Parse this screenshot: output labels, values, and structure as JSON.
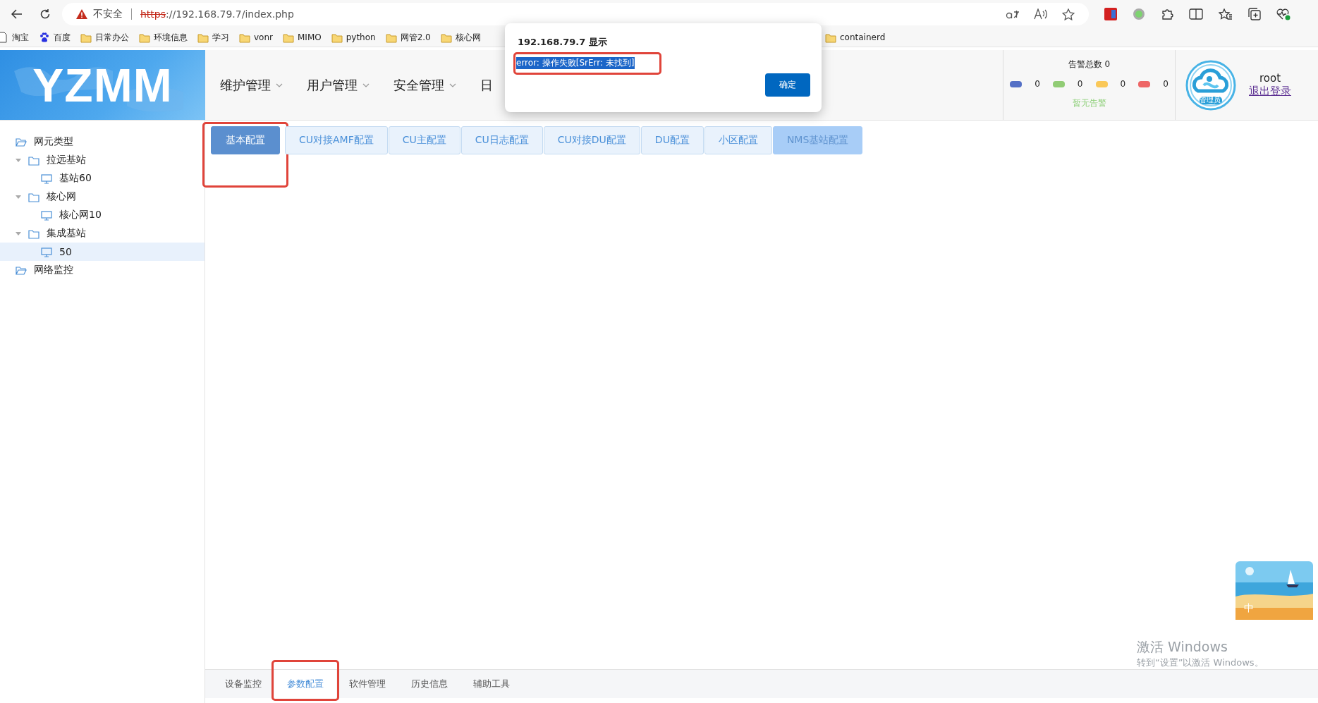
{
  "browser": {
    "security_label": "不安全",
    "url_scheme": "https",
    "url_rest": "://192.168.79.7/index.php",
    "bookmarks_left": [
      {
        "kind": "page",
        "label": "淘宝"
      },
      {
        "kind": "paw",
        "label": "百度"
      },
      {
        "kind": "folder",
        "label": "日常办公"
      },
      {
        "kind": "folder",
        "label": "环境信息"
      },
      {
        "kind": "folder",
        "label": "学习"
      },
      {
        "kind": "folder",
        "label": "vonr"
      },
      {
        "kind": "folder",
        "label": "MIMO"
      },
      {
        "kind": "folder",
        "label": "python"
      },
      {
        "kind": "folder",
        "label": "网管2.0"
      },
      {
        "kind": "folder",
        "label": "核心网"
      }
    ],
    "bookmarks_right": [
      {
        "kind": "folder",
        "label": "containerd"
      }
    ]
  },
  "header": {
    "logo": "YZMM",
    "nav": [
      {
        "label": "维护管理",
        "caret": true
      },
      {
        "label": "用户管理",
        "caret": true
      },
      {
        "label": "安全管理",
        "caret": true
      },
      {
        "label": "日",
        "caret": false
      }
    ],
    "alarms": {
      "title": "告警总数 0",
      "levels": [
        {
          "color": "#5470c6",
          "count": "0"
        },
        {
          "color": "#91cc75",
          "count": "0"
        },
        {
          "color": "#fac858",
          "count": "0"
        },
        {
          "color": "#ee6666",
          "count": "0"
        }
      ],
      "status": "暂无告警"
    },
    "user": {
      "badge": "管理员",
      "name": "root",
      "logout": "退出登录"
    }
  },
  "sidebar": {
    "tree": [
      {
        "kind": "folder-open",
        "label": "网元类型",
        "selected": false,
        "children": [
          {
            "kind": "folder",
            "label": "拉远基站",
            "expanded": true,
            "selected": false,
            "children": [
              {
                "kind": "monitor",
                "label": "基站60",
                "selected": false
              }
            ]
          },
          {
            "kind": "folder",
            "label": "核心网",
            "expanded": true,
            "selected": false,
            "children": [
              {
                "kind": "monitor",
                "label": "核心网10",
                "selected": false
              }
            ]
          },
          {
            "kind": "folder",
            "label": "集成基站",
            "expanded": true,
            "selected": false,
            "children": [
              {
                "kind": "monitor",
                "label": "50",
                "selected": true
              }
            ]
          }
        ]
      },
      {
        "kind": "folder-open",
        "label": "网络监控",
        "selected": false
      }
    ]
  },
  "config_tabs": [
    {
      "label": "基本配置",
      "selected": true,
      "disabled": false,
      "highlighted": true
    },
    {
      "label": "CU对接AMF配置",
      "selected": false,
      "disabled": false,
      "highlighted": false
    },
    {
      "label": "CU主配置",
      "selected": false,
      "disabled": false,
      "highlighted": false
    },
    {
      "label": "CU日志配置",
      "selected": false,
      "disabled": false,
      "highlighted": false
    },
    {
      "label": "CU对接DU配置",
      "selected": false,
      "disabled": false,
      "highlighted": false
    },
    {
      "label": "DU配置",
      "selected": false,
      "disabled": false,
      "highlighted": false
    },
    {
      "label": "小区配置",
      "selected": false,
      "disabled": false,
      "highlighted": false
    },
    {
      "label": "NMS基站配置",
      "selected": false,
      "disabled": true,
      "highlighted": false
    }
  ],
  "bottom_tabs": [
    {
      "label": "设备监控",
      "selected": false,
      "highlighted": false
    },
    {
      "label": "参数配置",
      "selected": true,
      "highlighted": true
    },
    {
      "label": "软件管理",
      "selected": false,
      "highlighted": false
    },
    {
      "label": "历史信息",
      "selected": false,
      "highlighted": false
    },
    {
      "label": "辅助工具",
      "selected": false,
      "highlighted": false
    }
  ],
  "dialog": {
    "title": "192.168.79.7 显示",
    "message": "error:  操作失败[SrErr: 未找到]",
    "message_selected": true,
    "message_highlighted": true,
    "button": "确定"
  },
  "ime_widget": {
    "label": "中"
  },
  "os_notice": {
    "title": "激活 Windows",
    "hint": "转到“设置”以激活 Windows。"
  }
}
